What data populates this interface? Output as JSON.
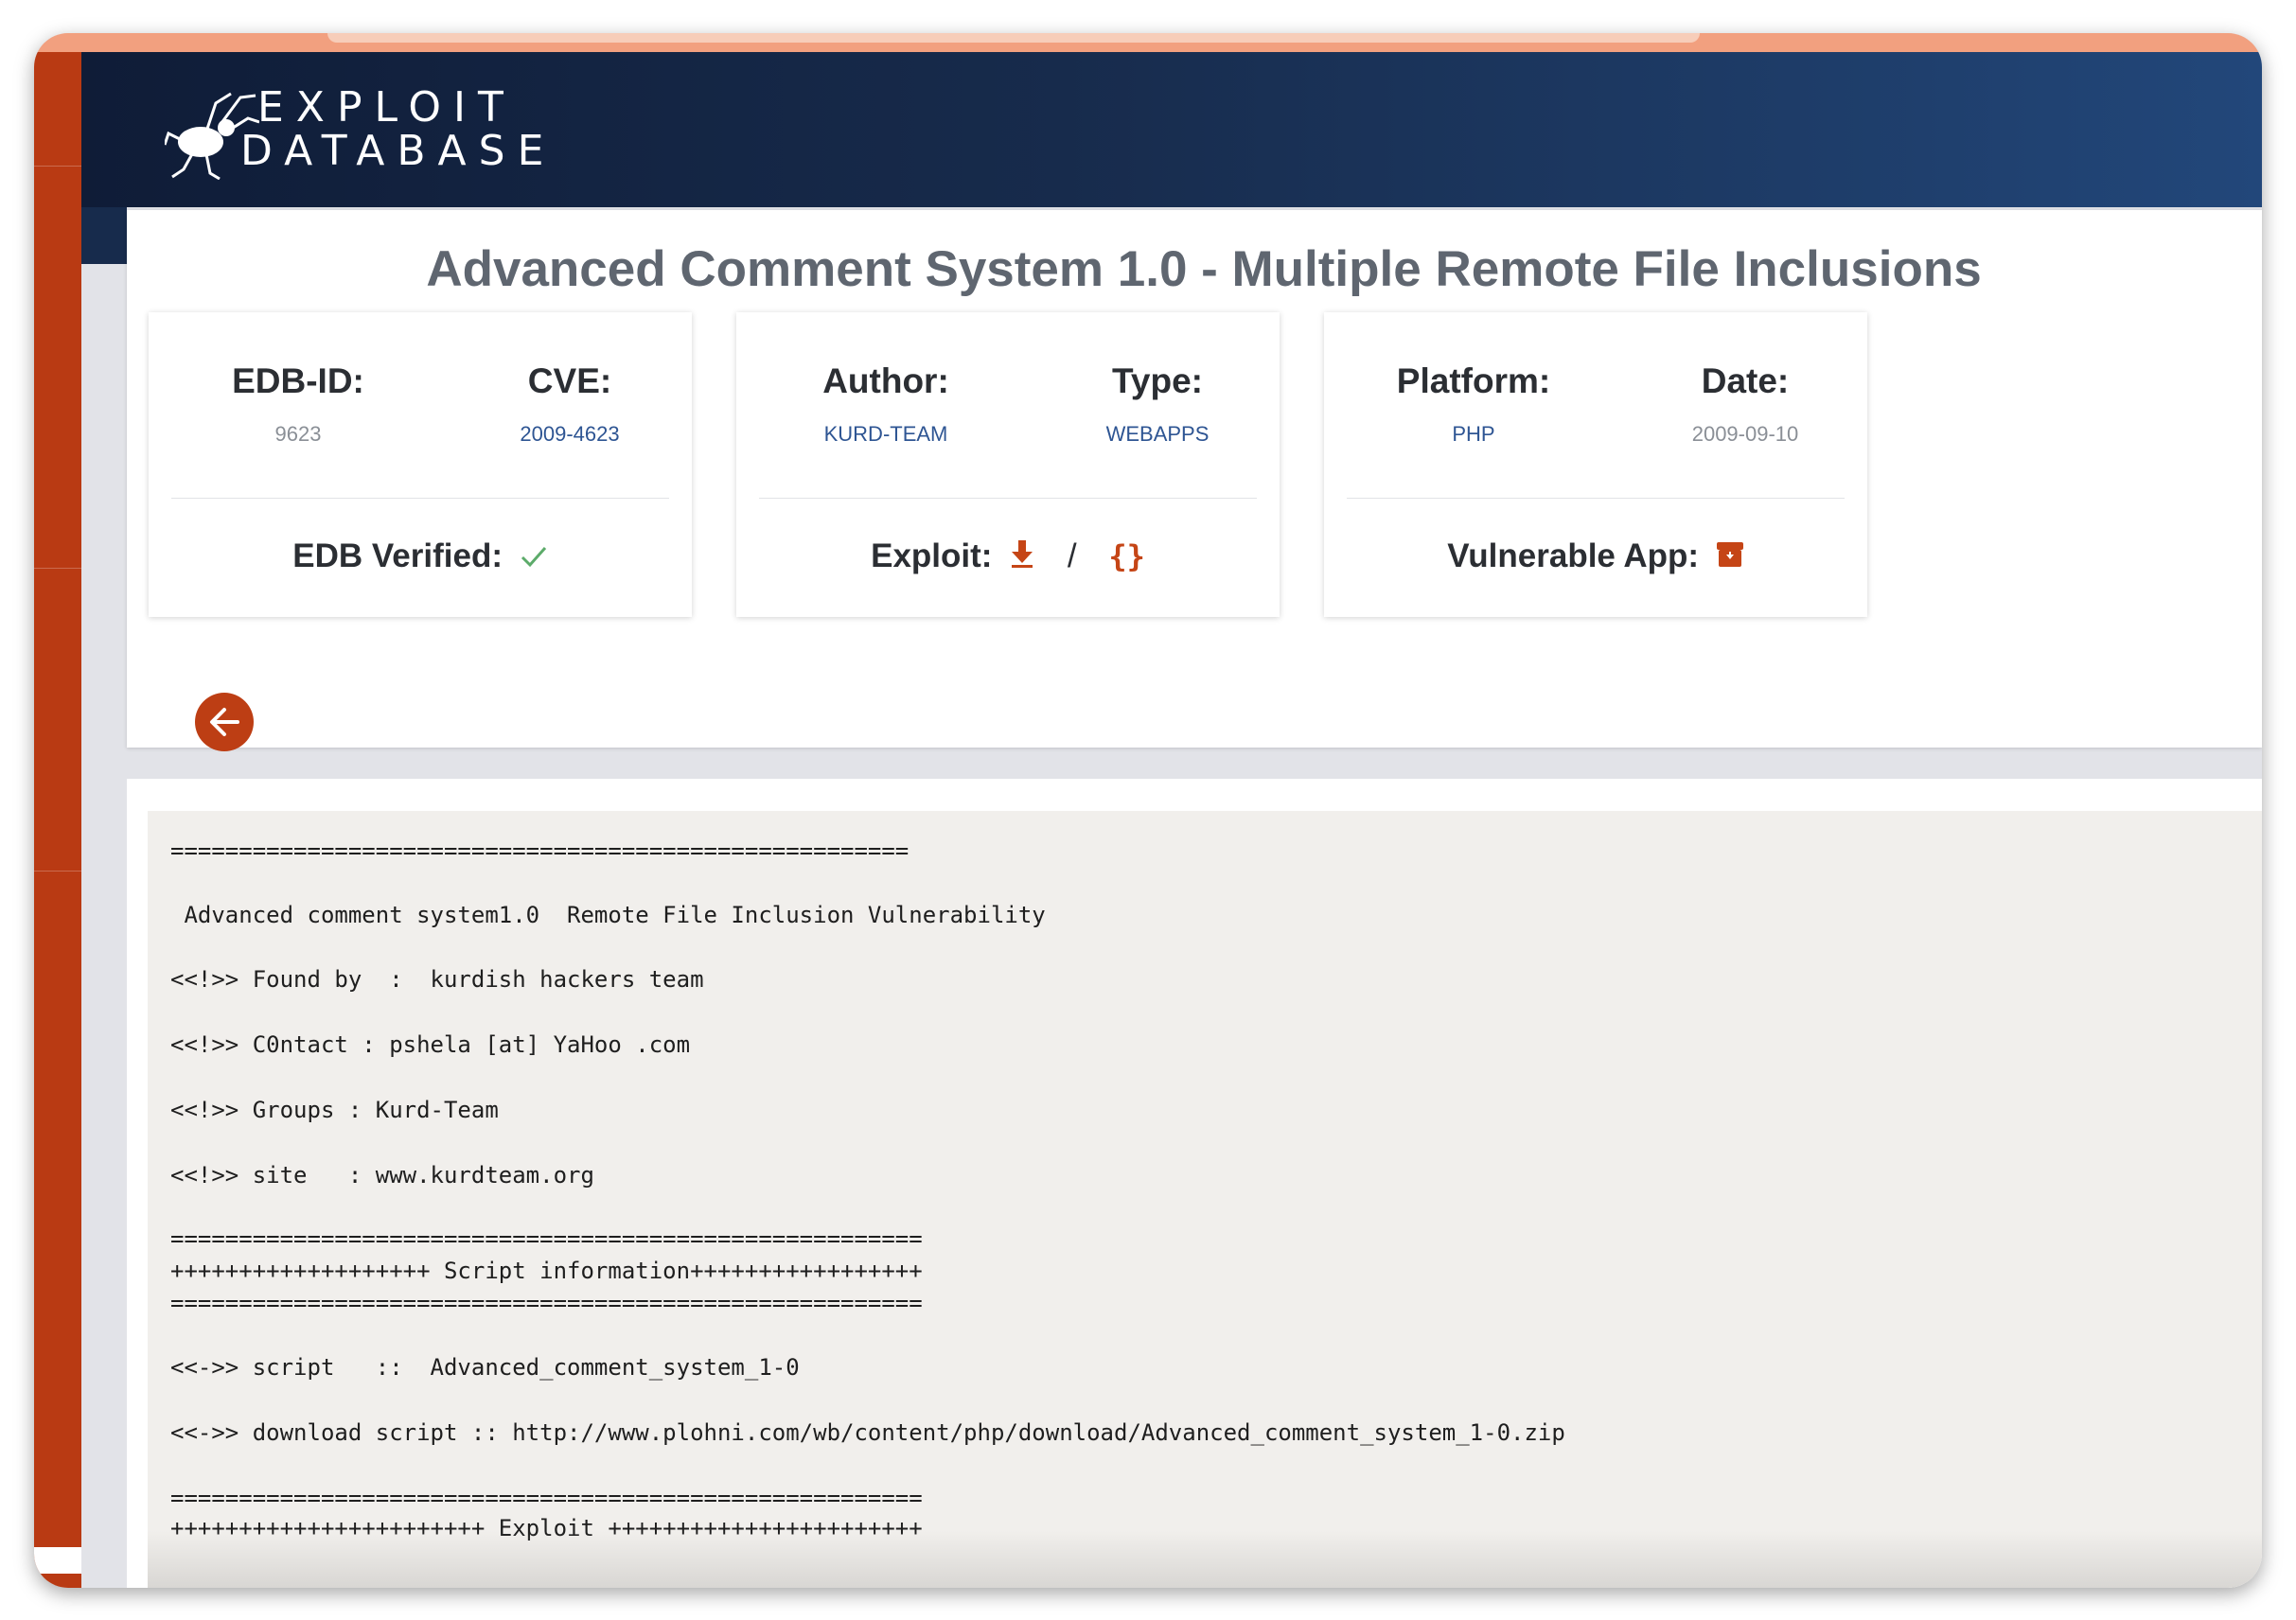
{
  "logo": {
    "line1": "EXPLOIT",
    "line2": "DATABASE"
  },
  "title": "Advanced Comment System 1.0 - Multiple Remote File Inclusions",
  "cards": {
    "c1": {
      "left_label": "EDB-ID:",
      "left_value": "9623",
      "right_label": "CVE:",
      "right_value": "2009-4623",
      "bottom_label": "EDB Verified:"
    },
    "c2": {
      "left_label": "Author:",
      "left_value": "KURD-TEAM",
      "right_label": "Type:",
      "right_value": "WEBAPPS",
      "bottom_label": "Exploit:",
      "slash": "/",
      "braces": "{}"
    },
    "c3": {
      "left_label": "Platform:",
      "left_value": "PHP",
      "right_label": "Date:",
      "right_value": "2009-09-10",
      "bottom_label": "Vulnerable App:"
    }
  },
  "code_lines": [
    "======================================================",
    " Advanced comment system1.0  Remote File Inclusion Vulnerability",
    "<<!>> Found by  :  kurdish hackers team",
    "<<!>> C0ntact : pshela [at] YaHoo .com",
    "<<!>> Groups : Kurd-Team",
    "<<!>> site   : www.kurdteam.org",
    "=======================================================",
    "+++++++++++++++++++ Script information+++++++++++++++++",
    "=======================================================",
    "<<->> script   ::  Advanced_comment_system_1-0",
    "<<->> download script :: http://www.plohni.com/wb/content/php/download/Advanced_comment_system_1-0.zip",
    "=======================================================",
    "+++++++++++++++++++++++ Exploit +++++++++++++++++++++++"
  ],
  "colors": {
    "accent": "#bd3e14",
    "header_dark": "#0f1c37",
    "header_light": "#22477a",
    "link": "#2e5593"
  },
  "icons": {
    "verified": "check-icon",
    "download": "download-icon",
    "archive": "archive-icon",
    "back": "arrow-left-icon"
  }
}
